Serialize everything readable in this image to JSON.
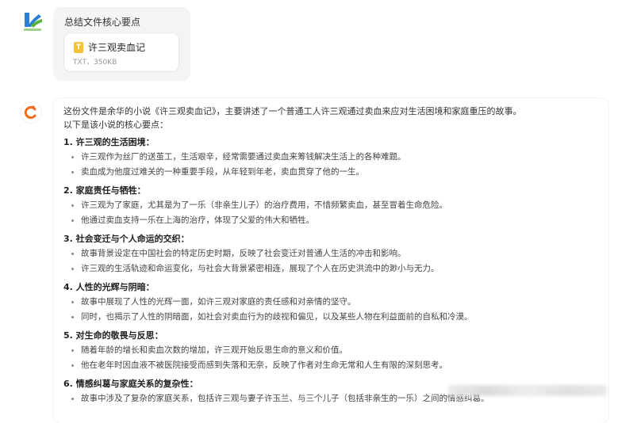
{
  "user": {
    "message": "总结文件核心要点",
    "file": {
      "icon_letter": "T",
      "name": "许三观卖血记",
      "meta": "TXT，350KB"
    },
    "avatar": {
      "colors": [
        "#2d7fd3",
        "#5bb53a"
      ]
    }
  },
  "assistant": {
    "avatar": {
      "accent": "#f26a1b"
    },
    "intro_1": "这份文件是余华的小说《许三观卖血记》，主要讲述了一个普通工人许三观通过卖血来应对生活困境和家庭重压的故事。",
    "intro_2": "以下是该小说的核心要点：",
    "sections": [
      {
        "title": "1. 许三观的生活困境：",
        "bullets": [
          "许三观作为丝厂的送茧工，生活艰辛，经常需要通过卖血来筹钱解决生活上的各种难题。",
          "卖血成为他度过难关的一种重要手段，从年轻到年老，卖血贯穿了他的一生。"
        ]
      },
      {
        "title": "2. 家庭责任与牺牲：",
        "bullets": [
          "许三观为了家庭，尤其是为了一乐（非亲生儿子）的治疗费用，不惜频繁卖血，甚至冒着生命危险。",
          "他通过卖血支持一乐在上海的治疗，体现了父爱的伟大和牺牲。"
        ]
      },
      {
        "title": "3. 社会变迁与个人命运的交织：",
        "bullets": [
          "故事背景设定在中国社会的特定历史时期，反映了社会变迁对普通人生活的冲击和影响。",
          "许三观的生活轨迹和命运变化，与社会大背景紧密相连，展现了个人在历史洪流中的渺小与无力。"
        ]
      },
      {
        "title": "4. 人性的光辉与阴暗：",
        "bullets": [
          "故事中展现了人性的光辉一面，如许三观对家庭的责任感和对亲情的坚守。",
          "同时，也揭示了人性的阴暗面，如社会对卖血行为的歧视和偏见，以及某些人物在利益面前的自私和冷漠。"
        ]
      },
      {
        "title": "5. 对生命的敬畏与反思：",
        "bullets": [
          "随着年龄的增长和卖血次数的增加，许三观开始反思生命的意义和价值。",
          "他在老年时因血液不被医院接受而感到失落和无奈，反映了作者对生命无常和人生有限的深刻思考。"
        ]
      },
      {
        "title": "6. 情感纠葛与家庭关系的复杂性：",
        "bullets": [
          "故事中涉及了复杂的家庭关系，包括许三观与妻子许玉兰、与三个儿子（包括非亲生的一乐）之间的情感纠葛。"
        ]
      }
    ]
  }
}
